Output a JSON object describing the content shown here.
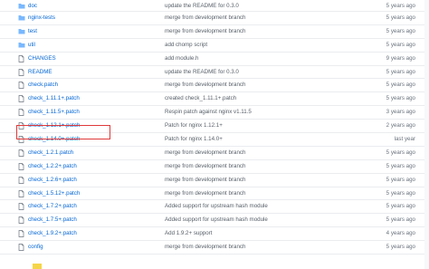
{
  "files": [
    {
      "type": "folder",
      "name": "doc",
      "message": "update the README for 0.3.0",
      "age": "5 years ago"
    },
    {
      "type": "folder",
      "name": "nginx-tests",
      "message": "merge from development branch",
      "age": "5 years ago"
    },
    {
      "type": "folder",
      "name": "test",
      "message": "merge from development branch",
      "age": "5 years ago"
    },
    {
      "type": "folder",
      "name": "util",
      "message": "add chomp script",
      "age": "5 years ago"
    },
    {
      "type": "file",
      "name": "CHANGES",
      "message": "add module.h",
      "age": "9 years ago"
    },
    {
      "type": "file",
      "name": "README",
      "message": "update the README for 0.3.0",
      "age": "5 years ago"
    },
    {
      "type": "file",
      "name": "check.patch",
      "message": "merge from development branch",
      "age": "5 years ago"
    },
    {
      "type": "file",
      "name": "check_1.11.1+.patch",
      "message": "created check_1.11.1+.patch",
      "age": "5 years ago"
    },
    {
      "type": "file",
      "name": "check_1.11.5+.patch",
      "message": "Respin patch against nginx v1.11.5",
      "age": "3 years ago"
    },
    {
      "type": "file",
      "name": "check_1.12.1+.patch",
      "message": "Patch for nginx 1.12.1+",
      "age": "2 years ago"
    },
    {
      "type": "file",
      "name": "check_1.14.0+.patch",
      "message": "Patch for nginx 1.14.0+",
      "age": "last year"
    },
    {
      "type": "file",
      "name": "check_1.2.1.patch",
      "message": "merge from development branch",
      "age": "5 years ago"
    },
    {
      "type": "file",
      "name": "check_1.2.2+.patch",
      "message": "merge from development branch",
      "age": "5 years ago"
    },
    {
      "type": "file",
      "name": "check_1.2.6+.patch",
      "message": "merge from development branch",
      "age": "5 years ago"
    },
    {
      "type": "file",
      "name": "check_1.5.12+.patch",
      "message": "merge from development branch",
      "age": "5 years ago"
    },
    {
      "type": "file",
      "name": "check_1.7.2+.patch",
      "message": "Added support for upstream hash module",
      "age": "5 years ago"
    },
    {
      "type": "file",
      "name": "check_1.7.5+.patch",
      "message": "Added support for upstream hash module",
      "age": "5 years ago"
    },
    {
      "type": "file",
      "name": "check_1.9.2+.patch",
      "message": "Add 1.9.2+ support",
      "age": "4 years ago"
    },
    {
      "type": "file",
      "name": "config",
      "message": "merge from development branch",
      "age": "5 years ago"
    }
  ],
  "colors": {
    "link": "#0366d6",
    "folder_icon": "#79b8ff",
    "file_icon": "#6a737d",
    "highlight_border": "#e03a3a"
  }
}
